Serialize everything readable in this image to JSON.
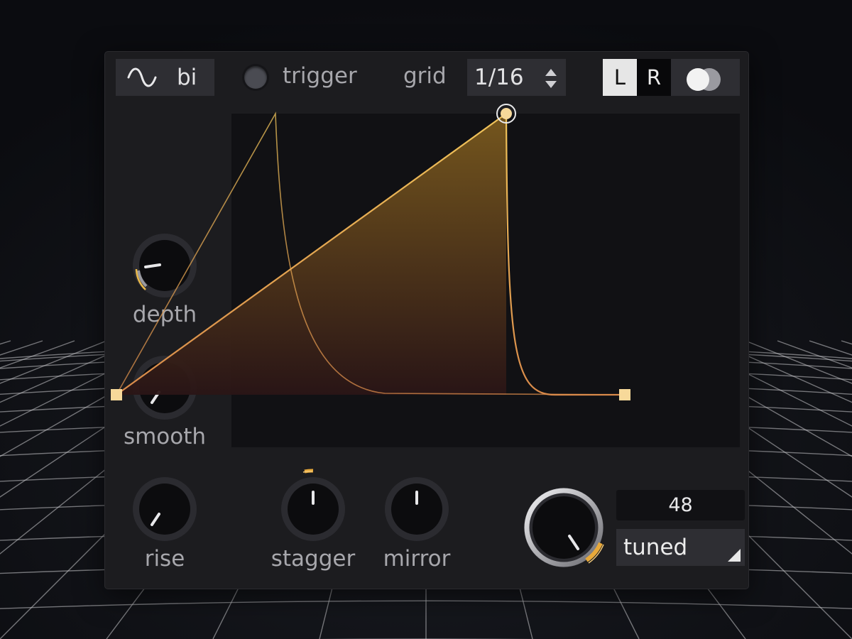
{
  "header": {
    "waveform_icon": "sine-wave-icon",
    "polarity_label": "bi",
    "trigger_label": "trigger",
    "grid_label": "grid",
    "grid_value": "1/16",
    "channel_left": "L",
    "channel_right": "R",
    "channel_active": "L"
  },
  "knobs": {
    "depth": {
      "label": "depth"
    },
    "smooth": {
      "label": "smooth"
    },
    "rise": {
      "label": "rise"
    },
    "stagger": {
      "label": "stagger"
    },
    "mirror": {
      "label": "mirror"
    }
  },
  "output": {
    "value": "48",
    "mode": "tuned"
  },
  "colors": {
    "panel": "#1c1c1f",
    "accent": "#e8b84a",
    "curve": "#f0c062",
    "fill_top": "#7a5a1e",
    "fill_bottom": "#2a1516"
  }
}
